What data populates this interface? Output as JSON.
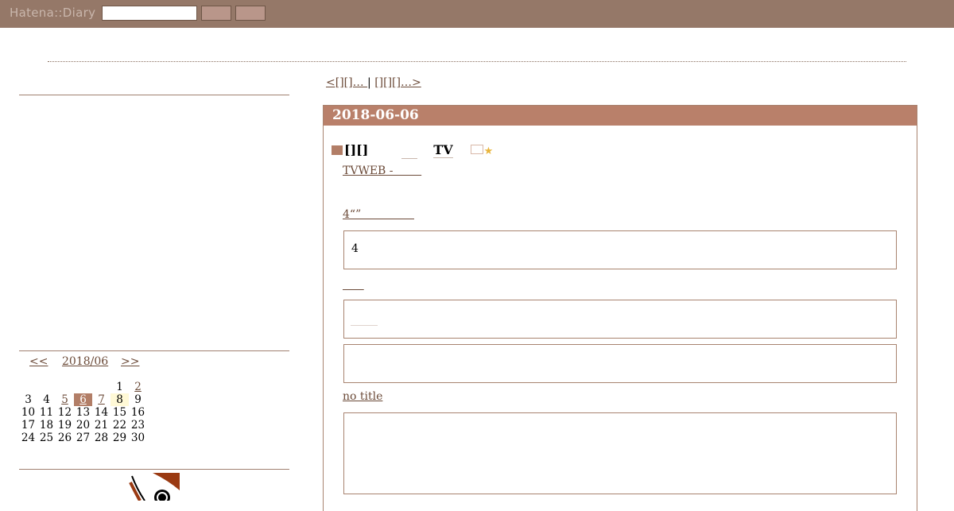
{
  "header": {
    "logo": "Hatena::Diary"
  },
  "pager": {
    "prev": "<[][]…      ",
    "separator": " | ",
    "next": "[][][]…>         "
  },
  "calendar": {
    "prev": "<<",
    "month": "2018/06",
    "next": ">>",
    "weeks": [
      [
        "",
        "",
        "",
        "",
        "",
        "1",
        "2"
      ],
      [
        "3",
        "4",
        "5",
        "6",
        "7",
        "8",
        "9"
      ],
      [
        "10",
        "11",
        "12",
        "13",
        "14",
        "15",
        "16"
      ],
      [
        "17",
        "18",
        "19",
        "20",
        "21",
        "22",
        "23"
      ],
      [
        "24",
        "25",
        "26",
        "27",
        "28",
        "29",
        "30"
      ]
    ],
    "linked_days": [
      "2",
      "5",
      "6",
      "7"
    ],
    "today": "6",
    "highlighted": "8"
  },
  "day": {
    "date": "2018-06-06",
    "section": {
      "title": "[][]",
      "tv": "TV"
    },
    "links": {
      "l1": "TVWEB -        ",
      "l2": "4“”               ",
      "l3": "      ",
      "l4": "no title"
    },
    "quote1": "4"
  },
  "icons": {
    "square": "square-icon",
    "image": "image-icon",
    "star": "star-icon",
    "mascot": "mascot-icon"
  },
  "colors": {
    "topbar": "#957868",
    "accent": "#b9806a",
    "link": "#6b4a38",
    "star": "#e8b43a"
  }
}
